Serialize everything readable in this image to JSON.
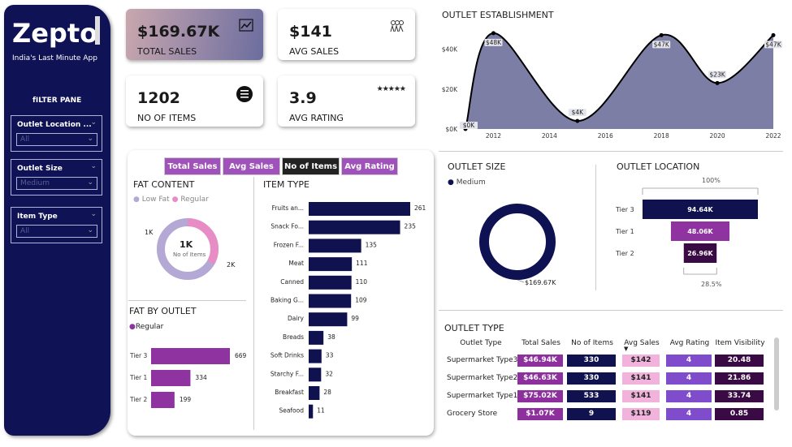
{
  "brand": {
    "name": "Zepto",
    "tagline": "India's Last Minute App"
  },
  "filter_pane": {
    "title": "fILTER PANE",
    "slicers": [
      {
        "label": "Outlet Location ...",
        "value": "All"
      },
      {
        "label": "Outlet Size",
        "value": "Medium"
      },
      {
        "label": "Item Type",
        "value": "All"
      }
    ]
  },
  "kpis": [
    {
      "value": "$169.67K",
      "label": "TOTAL SALES",
      "icon": "chart-icon"
    },
    {
      "value": "$141",
      "label": "AVG SALES",
      "icon": "people-icon"
    },
    {
      "value": "1202",
      "label": "NO OF ITEMS",
      "icon": "list-icon"
    },
    {
      "value": "3.9",
      "label": "AVG RATING",
      "icon": "stars-icon"
    }
  ],
  "tabs": [
    "Total Sales",
    "Avg Sales",
    "No of Items",
    "Avg Rating"
  ],
  "fat_content": {
    "title": "FAT CONTENT",
    "legend": [
      "Low Fat",
      "Regular"
    ],
    "center_value": "1K",
    "center_label": "No of Items",
    "label_left": "1K",
    "label_right": "2K",
    "colors": {
      "low_fat": "#b4a8d4",
      "regular": "#e88cc6"
    }
  },
  "fat_by_outlet": {
    "title": "FAT BY OUTLET",
    "legend": "Regular",
    "color": "#8e33a0"
  },
  "item_type": {
    "title": "ITEM TYPE"
  },
  "outlet_establishment": {
    "title": "OUTLET ESTABLISHMENT"
  },
  "outlet_size": {
    "title": "OUTLET SIZE",
    "legend": "Medium",
    "label": "$169.67K",
    "color": "#0e1152"
  },
  "outlet_location": {
    "title": "OUTLET LOCATION",
    "top_pct": "100%",
    "bottom_pct": "28.5%"
  },
  "outlet_type": {
    "title": "OUTLET TYPE",
    "headers": [
      "Outlet Type",
      "Total Sales",
      "No of Items",
      "Avg Sales",
      "Avg Rating",
      "Item Visibility"
    ],
    "rows": [
      [
        "Supermarket Type3",
        "$46.94K",
        "330",
        "$142",
        "4",
        "20.48"
      ],
      [
        "Supermarket Type2",
        "$46.63K",
        "330",
        "$141",
        "4",
        "21.86"
      ],
      [
        "Supermarket Type1",
        "$75.02K",
        "533",
        "$141",
        "4",
        "33.74"
      ],
      [
        "Grocery Store",
        "$1.07K",
        "9",
        "$119",
        "4",
        "0.85"
      ]
    ],
    "col_colors": [
      "#8e2f9e",
      "#10124f",
      "#f1b3dc",
      "#7f4ccc",
      "#3a0a44"
    ]
  },
  "chart_data": [
    {
      "type": "bar",
      "title": "ITEM TYPE",
      "categories": [
        "Fruits an...",
        "Snack Fo...",
        "Frozen F...",
        "Meat",
        "Canned",
        "Baking G...",
        "Dairy",
        "Breads",
        "Soft Drinks",
        "Starchy F...",
        "Breakfast",
        "Seafood"
      ],
      "values": [
        261,
        235,
        135,
        111,
        110,
        109,
        99,
        38,
        33,
        32,
        28,
        11
      ]
    },
    {
      "type": "bar",
      "title": "FAT BY OUTLET",
      "categories": [
        "Tier 3",
        "Tier 1",
        "Tier 2"
      ],
      "series": [
        {
          "name": "Regular",
          "values": [
            669,
            334,
            199
          ]
        }
      ]
    },
    {
      "type": "area",
      "title": "OUTLET ESTABLISHMENT",
      "x": [
        2011,
        2012,
        2015,
        2018,
        2020,
        2022
      ],
      "y": [
        0,
        48,
        4,
        47,
        23,
        47
      ],
      "data_labels": [
        "$0K",
        "$48K",
        "$4K",
        "$47K",
        "$23K",
        "$47K"
      ],
      "x_ticks": [
        "2012",
        "2014",
        "2016",
        "2018",
        "2020",
        "2022"
      ],
      "y_ticks": [
        "$0K",
        "$20K",
        "$40K"
      ],
      "ylim": [
        0,
        50
      ]
    },
    {
      "type": "pie",
      "title": "FAT CONTENT",
      "categories": [
        "Low Fat",
        "Regular"
      ],
      "values": [
        2,
        1
      ]
    },
    {
      "type": "bar",
      "title": "OUTLET LOCATION",
      "categories": [
        "Tier 3",
        "Tier 1",
        "Tier 2"
      ],
      "values": [
        94.64,
        48.06,
        26.96
      ],
      "data_labels": [
        "94.64K",
        "48.06K",
        "26.96K"
      ]
    }
  ]
}
